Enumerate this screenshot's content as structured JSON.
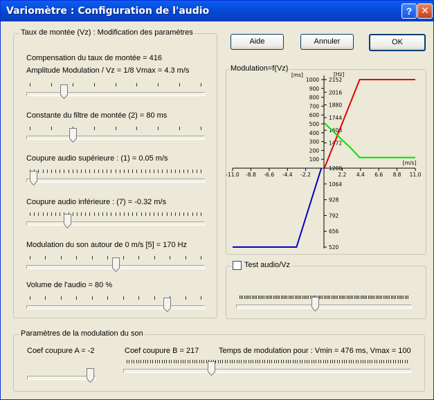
{
  "window": {
    "title": "Variomètre : Configuration de l'audio",
    "help_glyph": "?",
    "close_glyph": "✕"
  },
  "buttons": {
    "aide": "Aide",
    "annuler": "Annuler",
    "ok": "OK"
  },
  "vz_group": {
    "legend": "Taux de montée (Vz) : Modification des paramètres",
    "compensation": "Compensation du taux de montée = 416",
    "amplitude": "Amplitude Modulation / Vz = 1/8    Vmax = 4.3 m/s",
    "amplitude_level": 0.2,
    "constante": "Constante du filtre de montée (2) = 80 ms",
    "constante_level": 0.25,
    "coupure_sup": "Coupure audio supérieure : (1) = 0.05 m/s",
    "coupure_sup_level": 0.02,
    "coupure_inf": "Coupure audio inférieure : (7) = -0.32 m/s",
    "coupure_inf_level": 0.22,
    "modulation": "Modulation du son autour de 0 m/s [5] = 170 Hz",
    "modulation_level": 0.5,
    "volume": "Volume de l'audio = 80 %",
    "volume_level": 0.8
  },
  "graph_group": {
    "legend": "Modulation=f(Vz)",
    "left_unit": "[ms]",
    "right_unit": "[Hz]",
    "x_unit": "[m/s]",
    "y_ms_ticks": [
      "1000",
      "900",
      "800",
      "700",
      "600",
      "500",
      "400",
      "300",
      "200",
      "100"
    ],
    "y_hz_upper": [
      "2152",
      "2016",
      "1880",
      "1744",
      "1608",
      "1472"
    ],
    "y_hz_lower": [
      "1200",
      "1064",
      "928",
      "792",
      "656",
      "520"
    ],
    "x_neg_ticks": [
      "-11.0",
      "-8.8",
      "-6.6",
      "-4.4",
      "-2.2"
    ],
    "x_pos_ticks": [
      "2.2",
      "4.4",
      "6.6",
      "8.8",
      "11.0"
    ],
    "colors": {
      "frequency_positive": "#e00000",
      "period": "#00e000",
      "frequency_negative": "#0000c0"
    }
  },
  "chart_data": {
    "type": "line",
    "xlabel": "[m/s]",
    "ylabel": "[ms]",
    "xlim": [
      -11.0,
      11.0
    ],
    "series": [
      {
        "x": [
          0.05,
          4.3,
          11.0
        ],
        "y": [
          1200,
          2152,
          2152
        ]
      },
      {
        "x": [
          0.05,
          1.5,
          3.2,
          4.3,
          11.0
        ],
        "y": [
          510,
          380,
          230,
          120,
          120
        ]
      },
      {
        "x": [
          -11.0,
          -3.3,
          -0.32
        ],
        "y": [
          520,
          520,
          1200
        ]
      }
    ]
  },
  "test_group": {
    "label": "Test audio/Vz",
    "checked": false,
    "slider_level": 0.45
  },
  "mod_group": {
    "legend": "Paramètres de la modulation du son",
    "coef_a": "Coef coupure A = -2",
    "coef_a_level": 0.97,
    "coef_b": "Coef coupure B = 217",
    "coef_b_level": 0.3,
    "temps": "Temps de modulation pour : Vmin = 476 ms, Vmax = 100"
  }
}
